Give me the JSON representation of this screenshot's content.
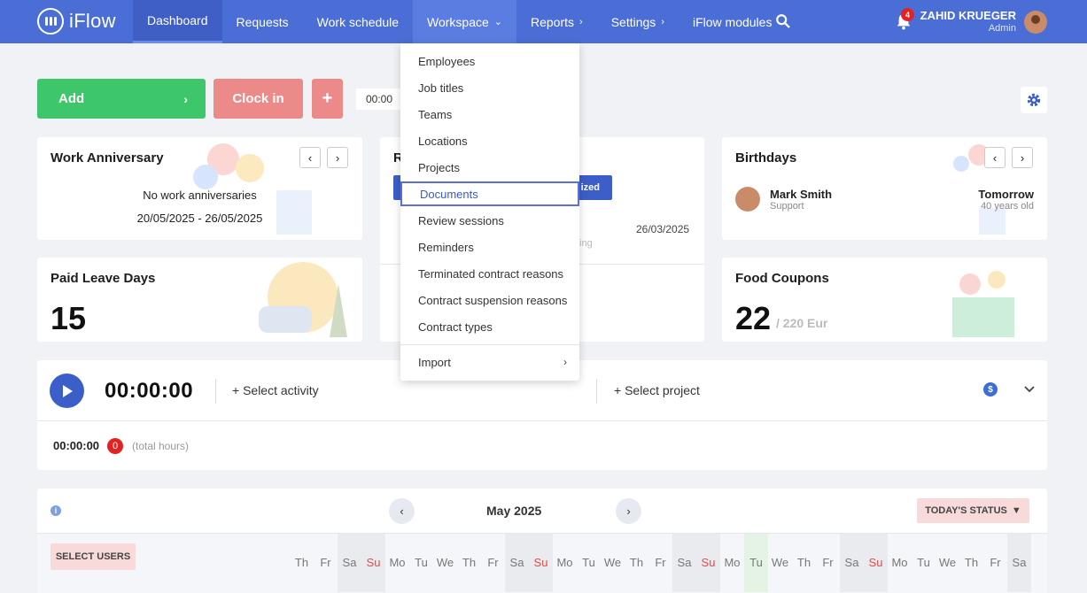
{
  "app": {
    "name": "iFlow"
  },
  "nav": {
    "items": [
      {
        "label": "Dashboard",
        "chev": ""
      },
      {
        "label": "Requests",
        "chev": ""
      },
      {
        "label": "Work schedule",
        "chev": ""
      },
      {
        "label": "Workspace",
        "chev": "⌄"
      },
      {
        "label": "Reports",
        "chev": "›"
      },
      {
        "label": "Settings",
        "chev": "›"
      },
      {
        "label": "iFlow modules",
        "chev": ""
      }
    ],
    "active": "Dashboard",
    "open": "Workspace"
  },
  "user": {
    "name": "ZAHID KRUEGER",
    "role": "Admin",
    "notifications": "4"
  },
  "actions": {
    "add": "Add",
    "clock_in": "Clock in",
    "plus": "+",
    "timer": "00:00"
  },
  "work_anniversary": {
    "title": "Work Anniversary",
    "empty": "No work anniversaries",
    "range": "20/05/2025 - 26/05/2025"
  },
  "middle_card": {
    "title_fragment": "R",
    "button_fragment": "ized",
    "date": "26/03/2025",
    "sub_fragment": "ting"
  },
  "birthdays": {
    "title": "Birthdays",
    "person": {
      "name": "Mark Smith",
      "dept": "Support"
    },
    "when": "Tomorrow",
    "age": "40 years old"
  },
  "paid_leave": {
    "title": "Paid Leave Days",
    "value": "15"
  },
  "food_coupons": {
    "title": "Food Coupons",
    "value": "22",
    "sub": "/ 220 Eur"
  },
  "timer": {
    "time": "00:00:00",
    "select_activity": "+ Select activity",
    "select_project": "+ Select project",
    "total": "00:00:00",
    "total_count": "0",
    "total_label": "(total hours)"
  },
  "calendar": {
    "month": "May 2025",
    "today_status": "TODAY'S STATUS",
    "select_users": "SELECT USERS",
    "days": [
      "Th",
      "Fr",
      "Sa",
      "Su",
      "Mo",
      "Tu",
      "We",
      "Th",
      "Fr",
      "Sa",
      "Su",
      "Mo",
      "Tu",
      "We",
      "Th",
      "Fr",
      "Sa",
      "Su",
      "Mo",
      "Tu",
      "We",
      "Th",
      "Fr",
      "Sa",
      "Su",
      "Mo",
      "Tu",
      "We",
      "Th",
      "Fr",
      "Sa"
    ]
  },
  "workspace_menu": {
    "items": [
      "Employees",
      "Job titles",
      "Teams",
      "Locations",
      "Projects",
      "Documents",
      "Review sessions",
      "Reminders",
      "Terminated contract reasons",
      "Contract suspension reasons",
      "Contract types"
    ],
    "selected": "Documents",
    "import": "Import"
  }
}
